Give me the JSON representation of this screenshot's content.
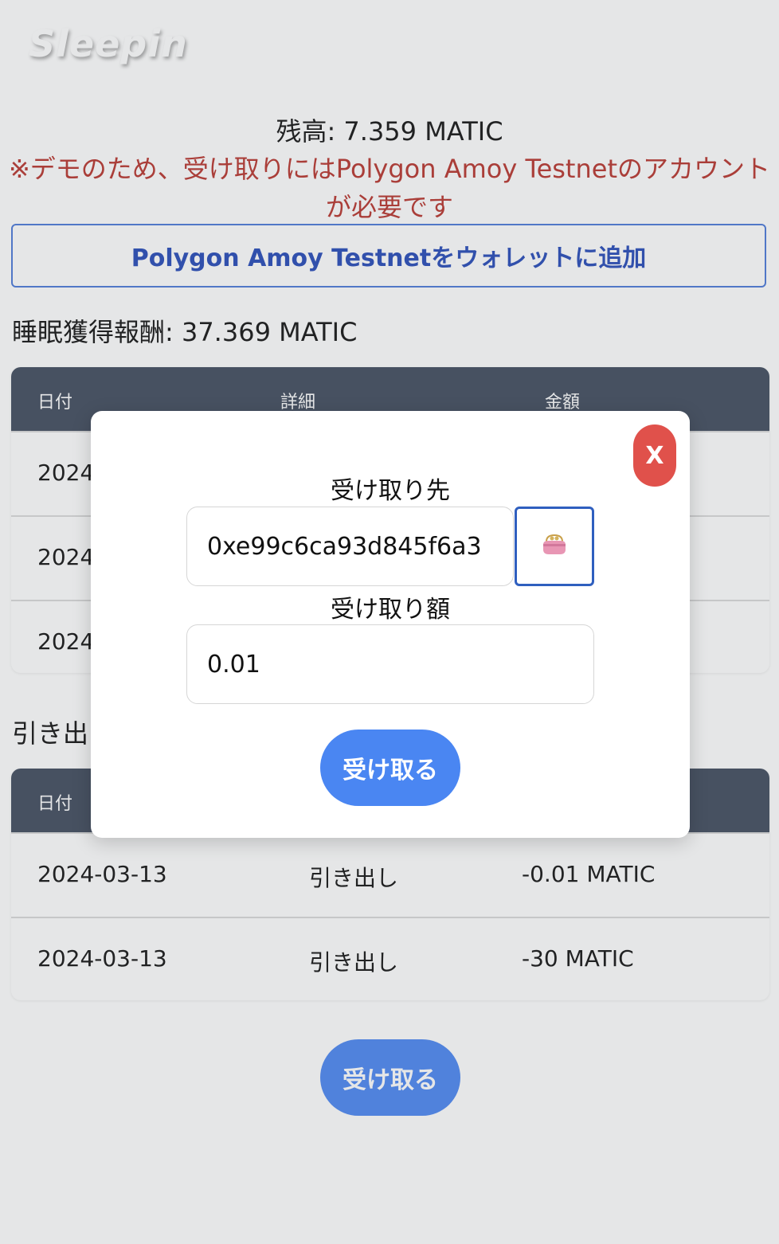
{
  "app": {
    "logo": "Sleepin"
  },
  "balance_text": "残高: 7.359 MATIC",
  "demo_note": "※デモのため、受け取りにはPolygon Amoy Testnetのアカウントが必要です",
  "add_network_button": "Polygon Amoy Testnetをウォレットに追加",
  "sleep_rewards_text": "睡眠獲得報酬: 37.369 MATIC",
  "rewards_table": {
    "headers": [
      "日付",
      "詳細",
      "金額"
    ],
    "rows": [
      {
        "date": "2024"
      },
      {
        "date": "2024"
      },
      {
        "date": "2024"
      }
    ]
  },
  "withdrawals_heading": "引き出",
  "withdrawals_table": {
    "headers": [
      "日付"
    ],
    "rows": [
      {
        "date": "2024-03-13",
        "detail": "引き出し",
        "amount": "-0.01 MATIC"
      },
      {
        "date": "2024-03-13",
        "detail": "引き出し",
        "amount": "-30 MATIC"
      }
    ]
  },
  "claim_button": "受け取る",
  "modal": {
    "close_label": "X",
    "recipient_label": "受け取り先",
    "recipient_value": "0xe99c6ca93d845f6a3",
    "wallet_icon": "purse-icon",
    "amount_label": "受け取り額",
    "amount_value": "0.01",
    "submit_label": "受け取る"
  },
  "colors": {
    "header_bg": "#3f4a5c",
    "accent_blue": "#4a86f2",
    "warning_red": "#b8322b",
    "close_red": "#e0514b"
  }
}
